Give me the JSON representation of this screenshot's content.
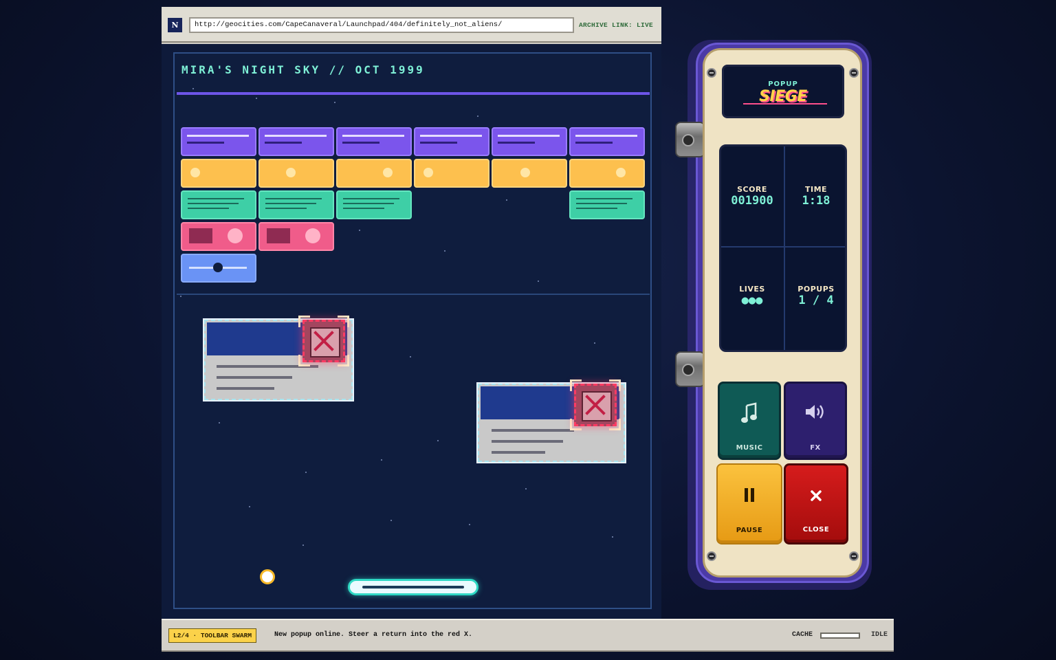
{
  "browser": {
    "favicon": "N",
    "url": "http://geocities.com/CapeCanaveral/Launchpad/404/definitely_not_aliens/",
    "archive_label": "ARCHIVE LINK: LIVE"
  },
  "webpage": {
    "title": "MIRA'S NIGHT SKY // OCT 1999"
  },
  "statusbar": {
    "level_badge": "L2/4 · TOOLBAR SWARM",
    "message": "New popup online. Steer a return into the red X.",
    "cache_label": "CACHE",
    "cache_level": 0,
    "state": "IDLE"
  },
  "console": {
    "logo_top": "POPUP",
    "logo_main": "SIEGE",
    "stats": {
      "score_label": "SCORE",
      "score": "001900",
      "time_label": "TIME",
      "time": "1:18",
      "lives_label": "LIVES",
      "lives": "●●●",
      "popups_label": "POPUPS",
      "popups": "1 / 4"
    },
    "buttons": {
      "music": "MUSIC",
      "fx": "FX",
      "pause": "PAUSE",
      "close": "CLOSE"
    },
    "icons": {
      "music": "music-note-icon",
      "fx": "speaker-icon",
      "pause": "pause-icon",
      "close": "close-icon"
    }
  },
  "colors": {
    "brick_purple": "#7b55ec",
    "brick_yellow": "#fdc04e",
    "brick_teal": "#3ecfa6",
    "brick_pink": "#f05c8a",
    "brick_blue": "#6a93f5",
    "target_red": "#ff3b63",
    "console_purple": "#4b3aa6",
    "console_cream": "#efe3c4",
    "accent_mint": "#7ef0d6"
  }
}
